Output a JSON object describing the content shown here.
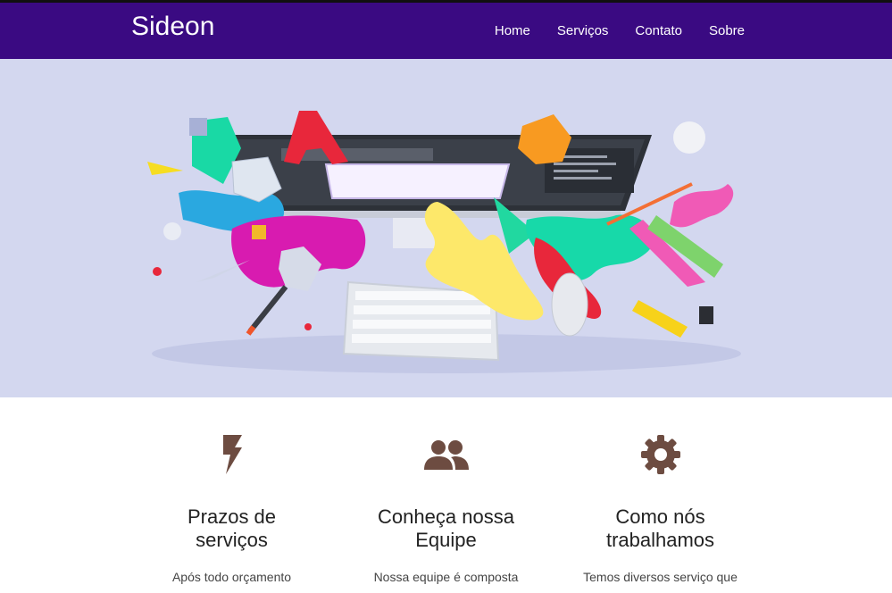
{
  "brand": "Sideon",
  "nav": {
    "items": [
      "Home",
      "Serviços",
      "Contato",
      "Sobre"
    ]
  },
  "hero": {
    "image_alt_icon": "workspace-illustration"
  },
  "features": [
    {
      "icon": "flash-icon",
      "title_line1": "Prazos de",
      "title_line2": "serviços",
      "text": "Após todo orçamento"
    },
    {
      "icon": "group-icon",
      "title_line1": "Conheça nossa",
      "title_line2": "Equipe",
      "text": "Nossa equipe é composta"
    },
    {
      "icon": "gear-icon",
      "title_line1": "Como nós",
      "title_line2": "trabalhamos",
      "text": "Temos diversos serviço que"
    }
  ],
  "colors": {
    "navbar": "#3a0a82",
    "hero_bg": "#d3d7ef",
    "icon_brown": "#6d4c41"
  }
}
